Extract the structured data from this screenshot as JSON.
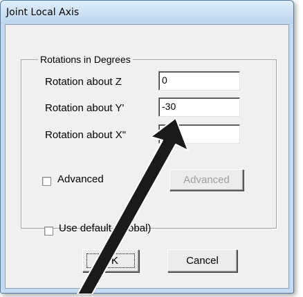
{
  "window": {
    "title": "Joint Local Axis"
  },
  "rotations": {
    "legend": "Rotations in Degrees",
    "z_label": "Rotation about  Z",
    "z_value": "0",
    "y_label": "Rotation about  Y'",
    "y_value": "-30",
    "x_label": "Rotation about  X\"",
    "x_value": "0",
    "advanced_check_label": "Advanced",
    "advanced_button_label": "Advanced"
  },
  "use_default": {
    "label": "Use default (Global)"
  },
  "buttons": {
    "ok_label": "OK",
    "cancel_label": "Cancel"
  },
  "colors": {
    "title_bar": "#c4daf0",
    "client": "#f0f0f0",
    "arrow_fill": "#1a1a1a"
  }
}
